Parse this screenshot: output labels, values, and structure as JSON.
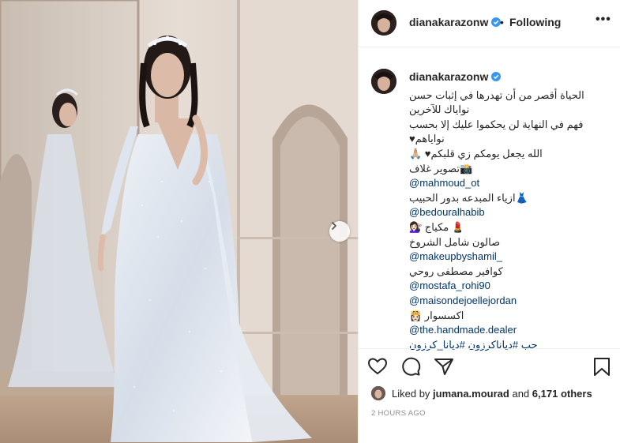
{
  "post": {
    "username": "dianakarazonw",
    "following_label": "Following",
    "separator": "•",
    "more_label": "•••",
    "caption_lines": [
      "الحياة أقصر من أن تهدرها في إثبات حسن",
      "نواياك للآخرين",
      "فهم في النهاية لن يحكموا عليك إلا بحسب",
      "نواياهم♥",
      "الله يجعل يومكم زي قلبكم♥ 🙏🏼",
      "📸تصوير غلاف",
      "@mahmoud_ot",
      "👗ازياء المبدعه بدور الحبيب",
      "@bedouralhabib",
      "💄 مكياج 💇🏻‍♀️",
      "صالون شامل الشروخ",
      "@makeupbyshamil_",
      "كوافير مصطفى روحي",
      "@mostafa_rohi90",
      "@maisondejoellejordan",
      "اكسسوار 👸🏻",
      "@the.handmade.dealer",
      "حب #دياناكرزون #ديانا_كرزون"
    ],
    "liked_by_prefix": "Liked by",
    "liked_by_user": "jumana.mourad",
    "liked_by_and": "and",
    "liked_by_others": "6,171 others",
    "timestamp": "2 HOURS AGO"
  },
  "colors": {
    "verified": "#3897f0",
    "mention": "#003569",
    "muted": "#8e8e8e"
  },
  "icons": [
    "heart-icon",
    "comment-icon",
    "share-icon",
    "bookmark-icon",
    "chevron-right-icon",
    "verified-badge-icon"
  ]
}
